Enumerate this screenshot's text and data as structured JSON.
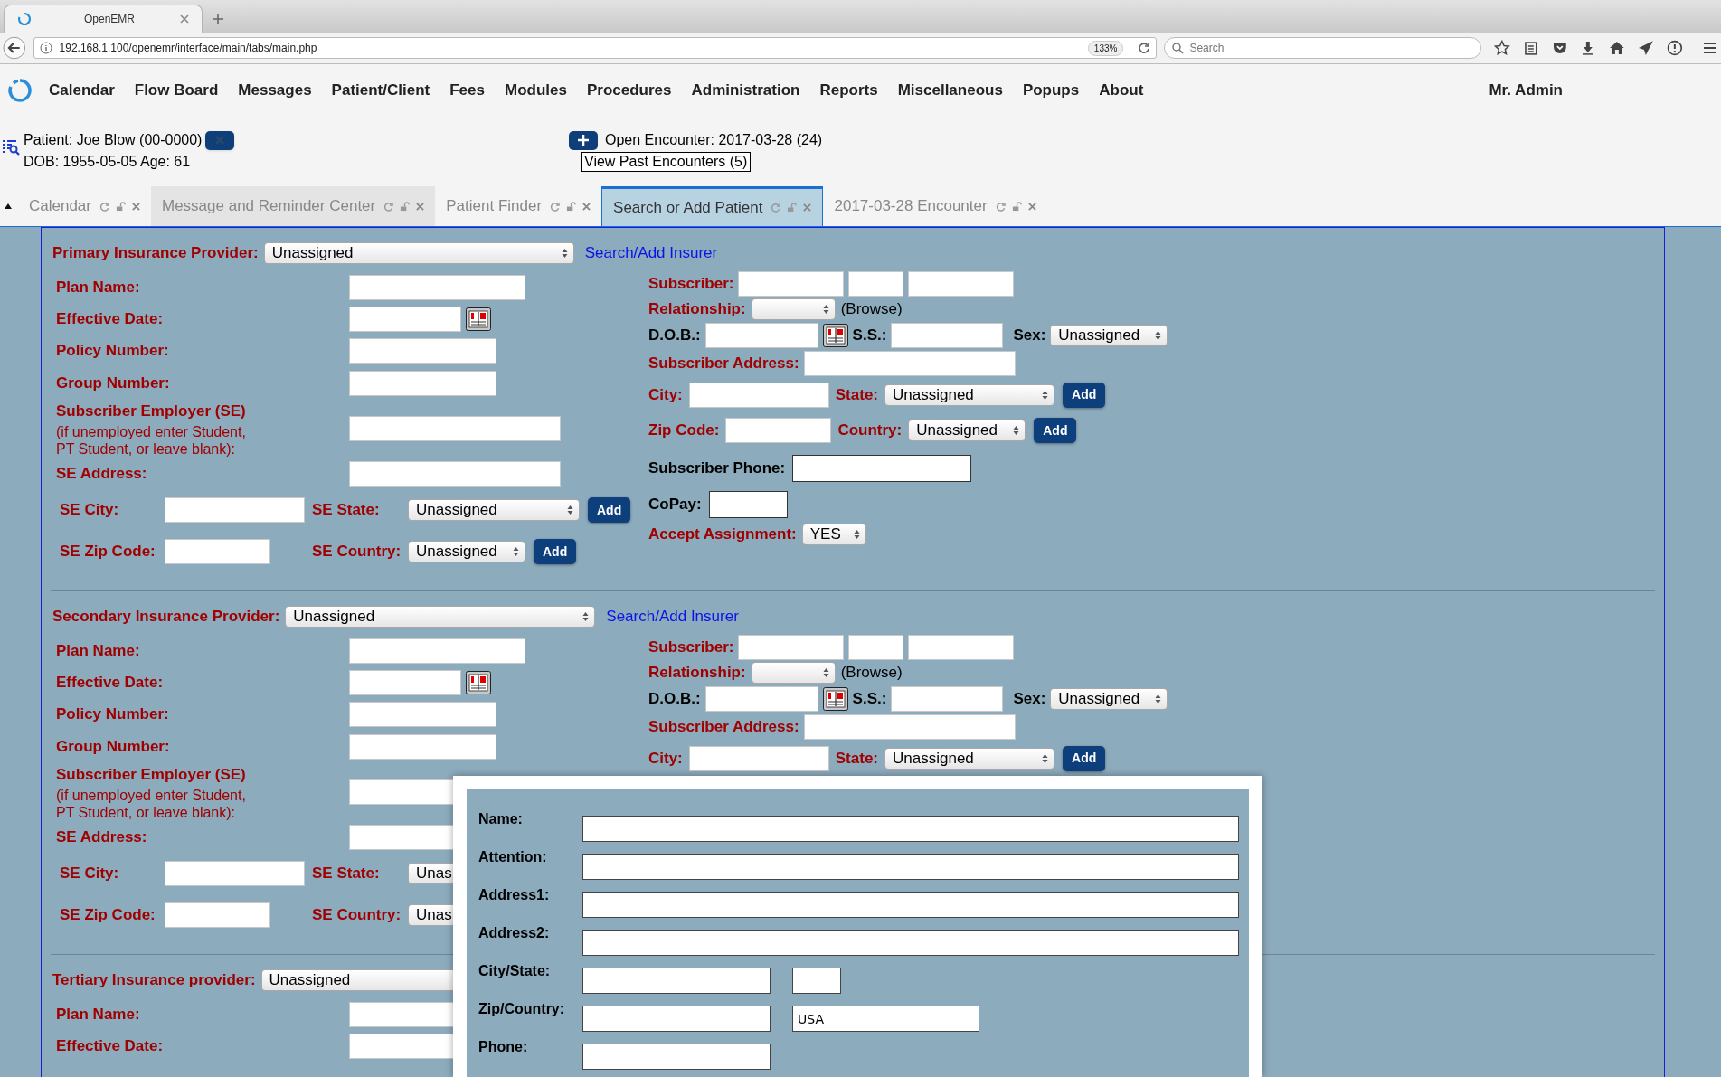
{
  "browser": {
    "tab_title": "OpenEMR",
    "url": "192.168.1.100/openemr/interface/main/tabs/main.php",
    "zoom": "133%",
    "search_placeholder": "Search"
  },
  "menu": {
    "items": [
      "Calendar",
      "Flow Board",
      "Messages",
      "Patient/Client",
      "Fees",
      "Modules",
      "Procedures",
      "Administration",
      "Reports",
      "Miscellaneous",
      "Popups",
      "About"
    ],
    "user": "Mr. Admin"
  },
  "patient": {
    "name": "Patient: Joe Blow (00-0000)",
    "dob": "DOB: 1955-05-05 Age: 61",
    "encounter": "Open Encounter: 2017-03-28 (24)",
    "past_encounters": "View Past Encounters (5)"
  },
  "tabs": [
    {
      "label": "Calendar",
      "selected": false,
      "hovered": false
    },
    {
      "label": "Message and Reminder Center",
      "selected": false,
      "hovered": true
    },
    {
      "label": "Patient Finder",
      "selected": false,
      "hovered": false
    },
    {
      "label": "Search or Add Patient",
      "selected": true,
      "hovered": false
    },
    {
      "label": "2017-03-28 Encounter",
      "selected": false,
      "hovered": false
    }
  ],
  "sections": [
    {
      "provider_label": "Primary Insurance Provider:",
      "provider_value": "Unassigned",
      "link": "Search/Add Insurer",
      "left": [
        {
          "kind": "plan",
          "label": "Plan Name:",
          "required": true
        },
        {
          "kind": "date",
          "label": "Effective Date:",
          "required": true
        },
        {
          "kind": "text",
          "label": "Policy Number:",
          "required": true
        },
        {
          "kind": "text",
          "label": "Group Number:",
          "required": true
        },
        {
          "kind": "employer",
          "label": "Subscriber Employer (SE)",
          "note": "(if unemployed enter Student,\nPT Student, or leave blank):",
          "required": true
        },
        {
          "kind": "long",
          "label": "SE Address:",
          "required": true
        },
        {
          "kind": "city",
          "label": "SE City:",
          "label2": "SE State:",
          "value": "Unassigned",
          "button": "Add",
          "required": true
        },
        {
          "kind": "zip",
          "label": "SE Zip Code:",
          "label2": "SE Country:",
          "value": "Unassigned",
          "button": "Add",
          "required": true
        }
      ],
      "right": [
        {
          "kind": "subscriber",
          "label": "Subscriber:",
          "required": true
        },
        {
          "kind": "relationship",
          "label": "Relationship:",
          "note": "(Browse)",
          "required": true
        },
        {
          "kind": "dob",
          "label": "D.O.B.:",
          "label2": "S.S.:",
          "label3": "Sex:",
          "value": "Unassigned",
          "required": false
        },
        {
          "kind": "address",
          "label": "Subscriber Address:",
          "required": true
        },
        {
          "kind": "city",
          "label": "City:",
          "label2": "State:",
          "value": "Unassigned",
          "button": "Add",
          "required": true
        },
        {
          "kind": "zip",
          "label": "Zip Code:",
          "label2": "Country:",
          "value": "Unassigned",
          "button": "Add",
          "required": true
        },
        {
          "kind": "phone",
          "label": "Subscriber Phone:",
          "required": false
        },
        {
          "kind": "copay",
          "label": "CoPay:",
          "required": false
        },
        {
          "kind": "select",
          "label": "Accept Assignment:",
          "value": "YES",
          "required": true
        }
      ]
    },
    {
      "provider_label": "Secondary Insurance Provider:",
      "provider_value": "Unassigned",
      "link": "Search/Add Insurer",
      "left": [
        {
          "kind": "plan",
          "label": "Plan Name:",
          "required": true
        },
        {
          "kind": "date",
          "label": "Effective Date:",
          "required": true
        },
        {
          "kind": "text",
          "label": "Policy Number:",
          "required": true
        },
        {
          "kind": "text",
          "label": "Group Number:",
          "required": true
        },
        {
          "kind": "employer",
          "label": "Subscriber Employer (SE)",
          "note": "(if unemployed enter Student,\nPT Student, or leave blank):",
          "required": true
        },
        {
          "kind": "long",
          "label": "SE Address:",
          "required": true
        },
        {
          "kind": "city",
          "label": "SE City:",
          "label2": "SE State:",
          "value": "Unas",
          "required": true
        },
        {
          "kind": "zip",
          "label": "SE Zip Code:",
          "label2": "SE Country:",
          "value": "Unas",
          "required": true
        }
      ],
      "right": [
        {
          "kind": "subscriber",
          "label": "Subscriber:",
          "required": true
        },
        {
          "kind": "relationship",
          "label": "Relationship:",
          "note": "(Browse)",
          "required": true
        },
        {
          "kind": "dob",
          "label": "D.O.B.:",
          "label2": "S.S.:",
          "label3": "Sex:",
          "value": "Unassigned",
          "required": false
        },
        {
          "kind": "address",
          "label": "Subscriber Address:",
          "required": true
        },
        {
          "kind": "city",
          "label": "City:",
          "label2": "State:",
          "value": "Unassigned",
          "button": "Add",
          "required": true
        }
      ]
    },
    {
      "provider_label": "Tertiary Insurance provider:",
      "provider_value": "Unassigned",
      "left": [
        {
          "kind": "plan",
          "label": "Plan Name:",
          "required": true
        },
        {
          "kind": "text",
          "label": "Effective Date:",
          "required": true
        }
      ]
    }
  ],
  "dialog": {
    "rows": [
      {
        "kind": "wide",
        "label": "Name:"
      },
      {
        "kind": "wide",
        "label": "Attention:"
      },
      {
        "kind": "wide",
        "label": "Address1:"
      },
      {
        "kind": "wide",
        "label": "Address2:"
      },
      {
        "kind": "city_state",
        "label": "City/State:"
      },
      {
        "kind": "zip_country",
        "label": "Zip/Country:",
        "value2": "USA"
      },
      {
        "kind": "single",
        "label": "Phone:"
      }
    ]
  }
}
